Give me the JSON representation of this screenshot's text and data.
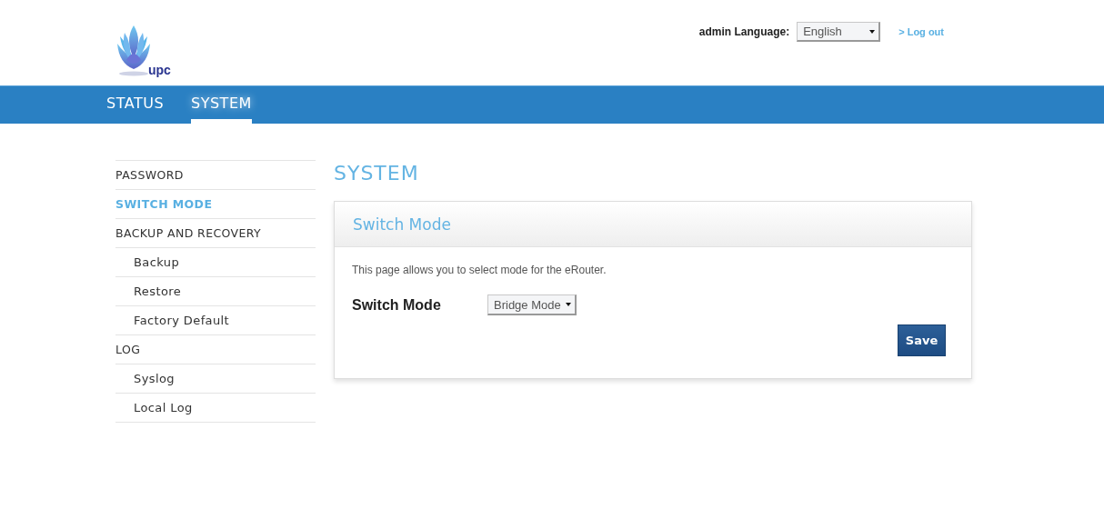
{
  "header": {
    "logo_text": "upc",
    "user": "admin",
    "language_label": "Language:",
    "language": "English",
    "logout": "> Log out"
  },
  "nav": [
    {
      "label": "STATUS",
      "selected": false
    },
    {
      "label": "SYSTEM",
      "selected": true
    }
  ],
  "sidebar": [
    {
      "label": "PASSWORD",
      "selected": false
    },
    {
      "label": "SWITCH MODE",
      "selected": true
    },
    {
      "label": "BACKUP AND RECOVERY",
      "selected": false,
      "children": [
        {
          "label": "Backup",
          "selected": false
        },
        {
          "label": "Restore",
          "selected": false
        },
        {
          "label": "Factory Default",
          "selected": false
        }
      ]
    },
    {
      "label": "LOG",
      "selected": false,
      "children": [
        {
          "label": "Syslog",
          "selected": false
        },
        {
          "label": "Local Log",
          "selected": false
        }
      ]
    }
  ],
  "page_title": "SYSTEM",
  "panel": {
    "title": "Switch Mode",
    "description": "This page allows you to select mode for the eRouter.",
    "field_label": "Switch Mode",
    "field_value": "Bridge Mode",
    "save": "Save"
  }
}
